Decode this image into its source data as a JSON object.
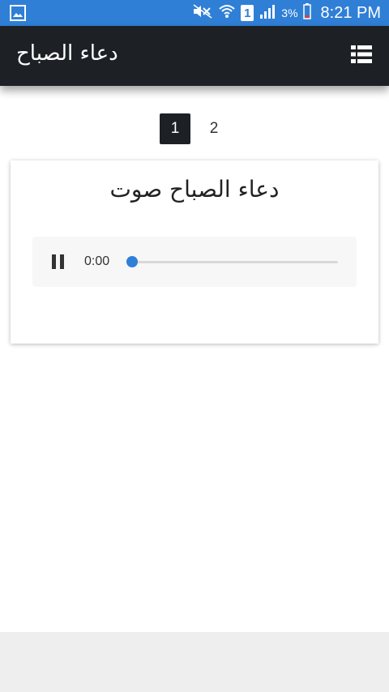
{
  "status_bar": {
    "time": "8:21 PM",
    "battery_percent": "3%",
    "sim_slot": "1",
    "icons": [
      "gallery-icon",
      "mute-icon",
      "wifi-icon",
      "sim-icon",
      "signal-icon",
      "battery-icon"
    ]
  },
  "app_bar": {
    "title": "دعاء الصباح",
    "menu_icon": "list-menu-icon"
  },
  "pagination": {
    "pages": [
      "1",
      "2"
    ],
    "active": "1"
  },
  "card": {
    "title": "دعاء الصباح صوت",
    "player": {
      "state": "playing",
      "time": "0:00",
      "progress": 0,
      "icon": "pause-icon"
    }
  },
  "colors": {
    "status_bar": "#2f7fd6",
    "app_bar": "#1d2125",
    "accent": "#2f7fd6",
    "bottom_area": "#eeeeee"
  }
}
